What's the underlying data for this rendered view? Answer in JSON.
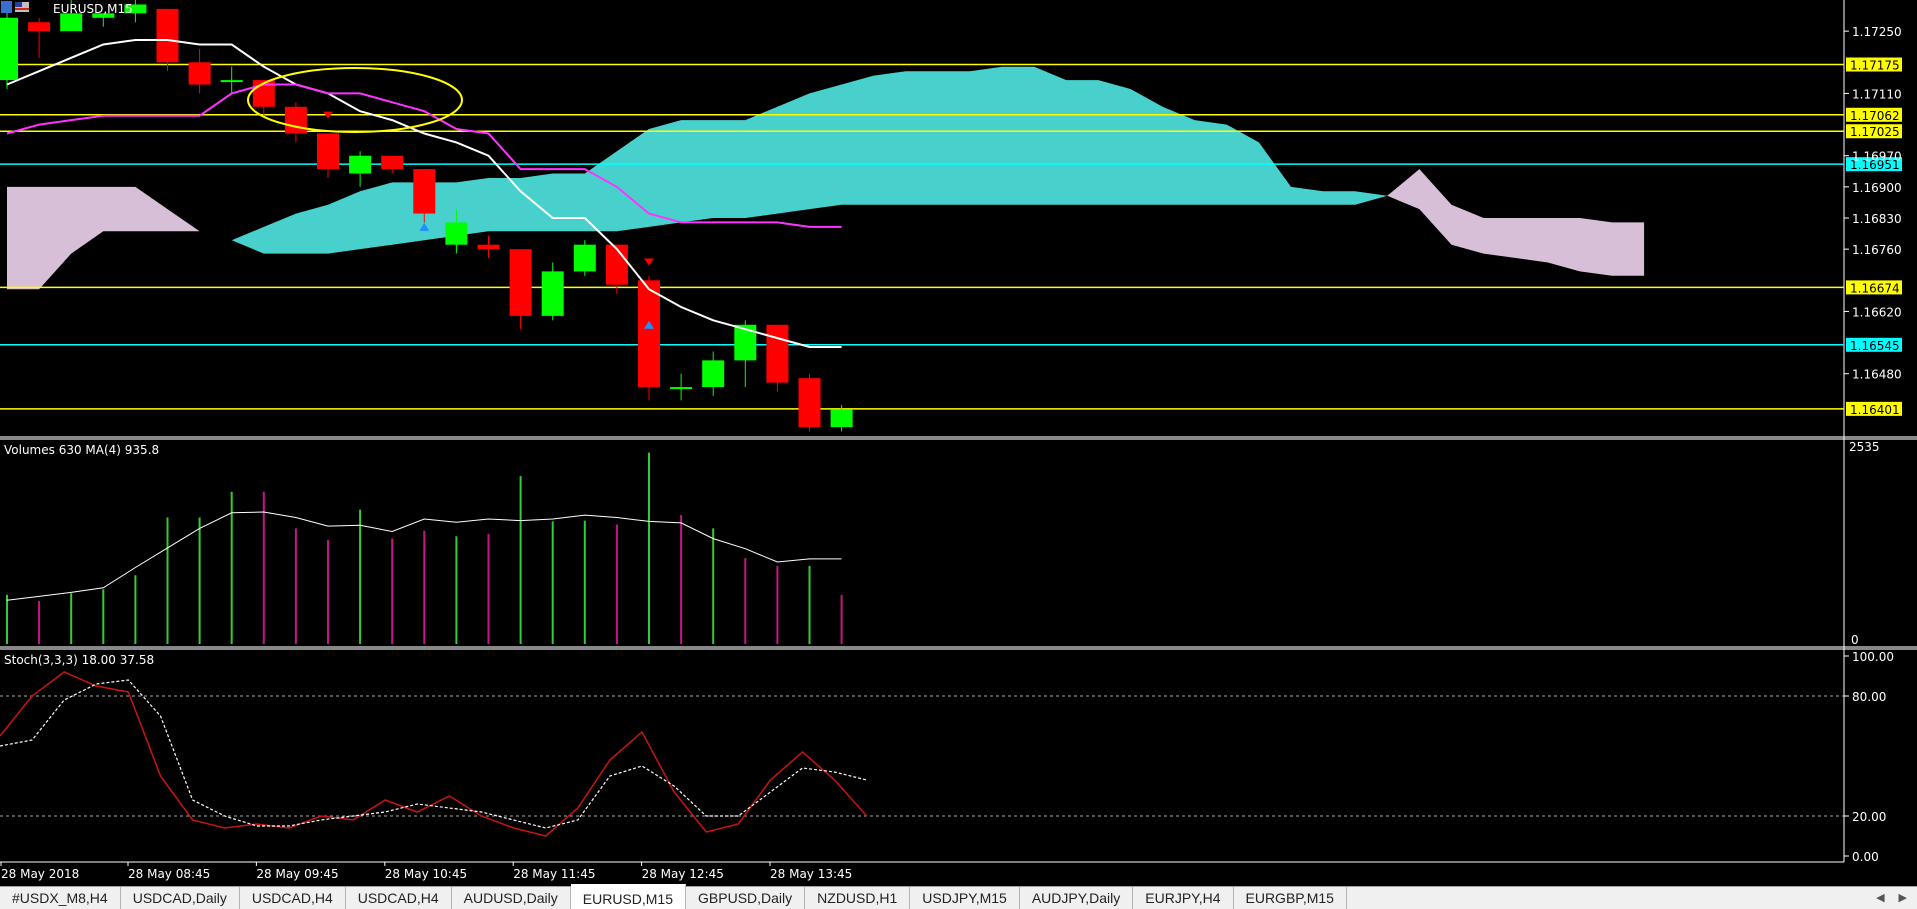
{
  "window": {
    "symbol_title": "EURUSD,M15"
  },
  "main_chart": {
    "price_range": [
      1.1634,
      1.1732
    ],
    "price_ticks": [
      "1.17250",
      "1.17110",
      "1.16970",
      "1.16900",
      "1.16830",
      "1.16760",
      "1.16620",
      "1.16480"
    ],
    "horizontal_lines": [
      {
        "label": "1.17175",
        "value": 1.17175,
        "color": "#ffff00"
      },
      {
        "label": "1.17062",
        "value": 1.17062,
        "color": "#ffff00"
      },
      {
        "label": "1.17025",
        "value": 1.17025,
        "color": "#ffff00"
      },
      {
        "label": "1.16951",
        "value": 1.16951,
        "color": "#00ffff"
      },
      {
        "label": "1.16674",
        "value": 1.16674,
        "color": "#ffff00"
      },
      {
        "label": "1.16545",
        "value": 1.16545,
        "color": "#00ffff"
      },
      {
        "label": "1.16401",
        "value": 1.16401,
        "color": "#ffff00"
      }
    ],
    "candles": [
      {
        "o": 1.1714,
        "h": 1.173,
        "l": 1.1712,
        "c": 1.1728
      },
      {
        "o": 1.1727,
        "h": 1.1728,
        "l": 1.1719,
        "c": 1.1725
      },
      {
        "o": 1.1725,
        "h": 1.1732,
        "l": 1.1725,
        "c": 1.1729
      },
      {
        "o": 1.1728,
        "h": 1.1729,
        "l": 1.1726,
        "c": 1.1729
      },
      {
        "o": 1.1729,
        "h": 1.1732,
        "l": 1.1727,
        "c": 1.1731
      },
      {
        "o": 1.173,
        "h": 1.173,
        "l": 1.1716,
        "c": 1.1718
      },
      {
        "o": 1.1718,
        "h": 1.1721,
        "l": 1.1711,
        "c": 1.1713
      },
      {
        "o": 1.1714,
        "h": 1.1717,
        "l": 1.1711,
        "c": 1.1714
      },
      {
        "o": 1.1714,
        "h": 1.1714,
        "l": 1.1706,
        "c": 1.1708
      },
      {
        "o": 1.1708,
        "h": 1.1709,
        "l": 1.17,
        "c": 1.1702
      },
      {
        "o": 1.1702,
        "h": 1.1702,
        "l": 1.1692,
        "c": 1.1694
      },
      {
        "o": 1.1693,
        "h": 1.1698,
        "l": 1.169,
        "c": 1.1697
      },
      {
        "o": 1.1697,
        "h": 1.1697,
        "l": 1.1693,
        "c": 1.1694
      },
      {
        "o": 1.1694,
        "h": 1.1694,
        "l": 1.1682,
        "c": 1.1684
      },
      {
        "o": 1.1677,
        "h": 1.1685,
        "l": 1.1675,
        "c": 1.1682
      },
      {
        "o": 1.1677,
        "h": 1.1679,
        "l": 1.1674,
        "c": 1.1676
      },
      {
        "o": 1.1676,
        "h": 1.1676,
        "l": 1.1658,
        "c": 1.1661
      },
      {
        "o": 1.1661,
        "h": 1.1673,
        "l": 1.166,
        "c": 1.1671
      },
      {
        "o": 1.1671,
        "h": 1.1678,
        "l": 1.167,
        "c": 1.1677
      },
      {
        "o": 1.1677,
        "h": 1.1677,
        "l": 1.1666,
        "c": 1.1668
      },
      {
        "o": 1.1669,
        "h": 1.167,
        "l": 1.1642,
        "c": 1.1645
      },
      {
        "o": 1.1645,
        "h": 1.1648,
        "l": 1.1642,
        "c": 1.1645
      },
      {
        "o": 1.1645,
        "h": 1.1653,
        "l": 1.1643,
        "c": 1.1651
      },
      {
        "o": 1.1651,
        "h": 1.166,
        "l": 1.1645,
        "c": 1.1659
      },
      {
        "o": 1.1659,
        "h": 1.1659,
        "l": 1.1644,
        "c": 1.1646
      },
      {
        "o": 1.1647,
        "h": 1.1648,
        "l": 1.1635,
        "c": 1.1636
      },
      {
        "o": 1.1636,
        "h": 1.1641,
        "l": 1.1635,
        "c": 1.164
      }
    ],
    "white_ma": [
      1.1713,
      1.1716,
      1.1719,
      1.1722,
      1.1723,
      1.1723,
      1.1722,
      1.1722,
      1.1717,
      1.1713,
      1.1711,
      1.1707,
      1.1705,
      1.1702,
      1.17,
      1.1697,
      1.1689,
      1.1683,
      1.1683,
      1.1676,
      1.1667,
      1.1663,
      1.166,
      1.1658,
      1.1656,
      1.1654,
      1.1654
    ],
    "magenta_ma": [
      1.1702,
      1.1704,
      1.1705,
      1.1706,
      1.1706,
      1.1706,
      1.1706,
      1.1711,
      1.1713,
      1.1713,
      1.1711,
      1.1711,
      1.1709,
      1.1707,
      1.1703,
      1.1702,
      1.1694,
      1.1694,
      1.1694,
      1.169,
      1.1684,
      1.1682,
      1.1682,
      1.1682,
      1.1682,
      1.1681,
      1.1681
    ],
    "cloud_cyan_top": [
      null,
      null,
      null,
      null,
      null,
      null,
      null,
      1.1678,
      1.1681,
      1.1684,
      1.1686,
      1.1689,
      1.1691,
      1.1691,
      1.1691,
      1.1692,
      1.1692,
      1.1693,
      1.1693,
      1.1698,
      1.1703,
      1.1705,
      1.1705,
      1.1705,
      1.1708,
      1.1711,
      1.1713,
      1.1715,
      1.1716,
      1.1716,
      1.1716,
      1.1717,
      1.1717,
      1.1714,
      1.1714,
      1.1712,
      1.1708,
      1.1705,
      1.1704,
      1.17,
      1.169,
      1.1689,
      1.1689,
      1.1688
    ],
    "cloud_cyan_bottom": [
      null,
      null,
      null,
      null,
      null,
      null,
      null,
      1.1678,
      1.1675,
      1.1675,
      1.1675,
      1.1676,
      1.1677,
      1.1678,
      1.1679,
      1.168,
      1.168,
      1.168,
      1.168,
      1.168,
      1.1681,
      1.1682,
      1.1683,
      1.1683,
      1.1684,
      1.1685,
      1.1686,
      1.1686,
      1.1686,
      1.1686,
      1.1686,
      1.1686,
      1.1686,
      1.1686,
      1.1686,
      1.1686,
      1.1686,
      1.1686,
      1.1686,
      1.1686,
      1.1686,
      1.1686,
      1.1686,
      1.1688
    ],
    "cloud_pink_top": [
      1.169,
      1.169,
      1.169,
      1.169,
      1.169,
      1.1685,
      1.168,
      1.1678,
      null,
      null,
      null,
      null,
      null,
      null,
      null,
      null,
      null,
      null,
      null,
      null,
      null,
      null,
      null,
      null,
      null,
      null,
      null,
      null,
      null,
      null,
      null,
      null,
      null,
      null,
      null,
      null,
      null,
      null,
      null,
      null,
      null,
      null,
      null,
      1.1688,
      1.1694,
      1.1686,
      1.1683,
      1.1683,
      1.1683,
      1.1683,
      1.1682,
      1.1682
    ],
    "cloud_pink_bottom": [
      1.1667,
      1.1667,
      1.1675,
      1.168,
      1.168,
      1.168,
      1.168,
      1.1678,
      null,
      null,
      null,
      null,
      null,
      null,
      null,
      null,
      null,
      null,
      null,
      null,
      null,
      null,
      null,
      null,
      null,
      null,
      null,
      null,
      null,
      null,
      null,
      null,
      null,
      null,
      null,
      null,
      null,
      null,
      null,
      null,
      null,
      null,
      null,
      1.1688,
      1.1685,
      1.1677,
      1.1675,
      1.1674,
      1.1673,
      1.1671,
      1.167,
      1.167
    ]
  },
  "volumes": {
    "label": "Volumes 630 MA(4) 935.8",
    "max_label": "2535",
    "min_label": "0",
    "max": 2535,
    "bars": [
      {
        "v": 630,
        "up": true
      },
      {
        "v": 550,
        "up": false
      },
      {
        "v": 650,
        "up": true
      },
      {
        "v": 700,
        "up": true
      },
      {
        "v": 880,
        "up": true
      },
      {
        "v": 1620,
        "up": true
      },
      {
        "v": 1620,
        "up": true
      },
      {
        "v": 1950,
        "up": true
      },
      {
        "v": 1950,
        "up": false
      },
      {
        "v": 1480,
        "up": false
      },
      {
        "v": 1330,
        "up": false
      },
      {
        "v": 1720,
        "up": true
      },
      {
        "v": 1350,
        "up": false
      },
      {
        "v": 1450,
        "up": false
      },
      {
        "v": 1380,
        "up": true
      },
      {
        "v": 1410,
        "up": false
      },
      {
        "v": 2150,
        "up": true
      },
      {
        "v": 1570,
        "up": true
      },
      {
        "v": 1580,
        "up": true
      },
      {
        "v": 1530,
        "up": false
      },
      {
        "v": 2450,
        "up": true
      },
      {
        "v": 1650,
        "up": false
      },
      {
        "v": 1480,
        "up": true
      },
      {
        "v": 1100,
        "up": false
      },
      {
        "v": 1000,
        "up": false
      },
      {
        "v": 1000,
        "up": true
      },
      {
        "v": 630,
        "up": false
      }
    ],
    "ma": [
      560,
      610,
      660,
      720,
      980,
      1230,
      1480,
      1680,
      1690,
      1620,
      1510,
      1520,
      1440,
      1600,
      1560,
      1600,
      1580,
      1600,
      1650,
      1620,
      1570,
      1550,
      1350,
      1220,
      1050,
      1090,
      1090
    ]
  },
  "stochastic": {
    "label": "Stoch(3,3,3) 18.00 37.58",
    "ticks": [
      "100.00",
      "80.00",
      "20.00",
      "0.00"
    ],
    "main": [
      60,
      80,
      92,
      85,
      82,
      40,
      18,
      14,
      16,
      14,
      20,
      18,
      28,
      22,
      30,
      20,
      14,
      10,
      24,
      48,
      62,
      32,
      12,
      16,
      38,
      52,
      38,
      20
    ],
    "signal": [
      55,
      58,
      78,
      86,
      88,
      70,
      28,
      20,
      15,
      15,
      18,
      20,
      22,
      26,
      24,
      22,
      18,
      14,
      18,
      40,
      45,
      35,
      20,
      20,
      32,
      44,
      42,
      38
    ]
  },
  "time_axis": [
    "28 May 2018",
    "28 May 08:45",
    "28 May 09:45",
    "28 May 10:45",
    "28 May 11:45",
    "28 May 12:45",
    "28 May 13:45"
  ],
  "tabs": [
    {
      "label": "#USDX_M8,H4",
      "active": false
    },
    {
      "label": "USDCAD,Daily",
      "active": false
    },
    {
      "label": "USDCAD,H4",
      "active": false
    },
    {
      "label": "USDCAD,H4",
      "active": false
    },
    {
      "label": "AUDUSD,Daily",
      "active": false
    },
    {
      "label": "EURUSD,M15",
      "active": true
    },
    {
      "label": "GBPUSD,Daily",
      "active": false
    },
    {
      "label": "NZDUSD,H1",
      "active": false
    },
    {
      "label": "USDJPY,M15",
      "active": false
    },
    {
      "label": "AUDJPY,Daily",
      "active": false
    },
    {
      "label": "EURJPY,H4",
      "active": false
    },
    {
      "label": "EURGBP,M15",
      "active": false
    }
  ],
  "colors": {
    "bull": "#00ff00",
    "bear": "#ff0000",
    "background": "#000000",
    "cloud_up": "#48d1cc",
    "cloud_down": "#d8bfd8",
    "ellipse": "#ffff00",
    "vol_up": "#32cd32",
    "vol_down": "#c71585",
    "stoch_main": "#c81414",
    "stoch_signal": "#ffffff"
  }
}
